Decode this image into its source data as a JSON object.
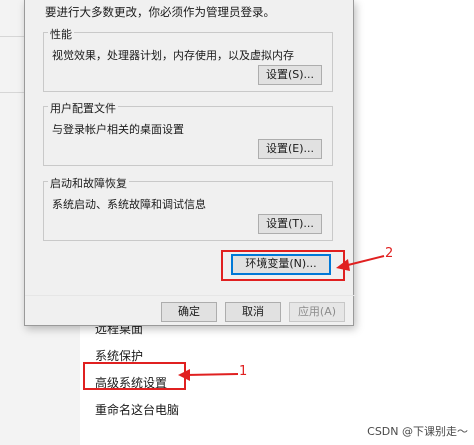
{
  "background": {
    "related_links": [
      "远程桌面",
      "系统保护",
      "高级系统设置",
      "重命名这台电脑"
    ]
  },
  "dialog": {
    "admin_note": "要进行大多数更改，你必须作为管理员登录。",
    "performance": {
      "title": "性能",
      "description": "视觉效果，处理器计划，内存使用，以及虚拟内存",
      "button": "设置(S)..."
    },
    "user_profiles": {
      "title": "用户配置文件",
      "description": "与登录帐户相关的桌面设置",
      "button": "设置(E)..."
    },
    "startup_recovery": {
      "title": "启动和故障恢复",
      "description": "系统启动、系统故障和调试信息",
      "button": "设置(T)..."
    },
    "env_button": "环境变量(N)...",
    "ok_button": "确定",
    "cancel_button": "取消",
    "apply_button": "应用(A)"
  },
  "annotations": {
    "step1": "1",
    "step2": "2",
    "color": "#e02020"
  },
  "watermark": "CSDN @下课别走～"
}
